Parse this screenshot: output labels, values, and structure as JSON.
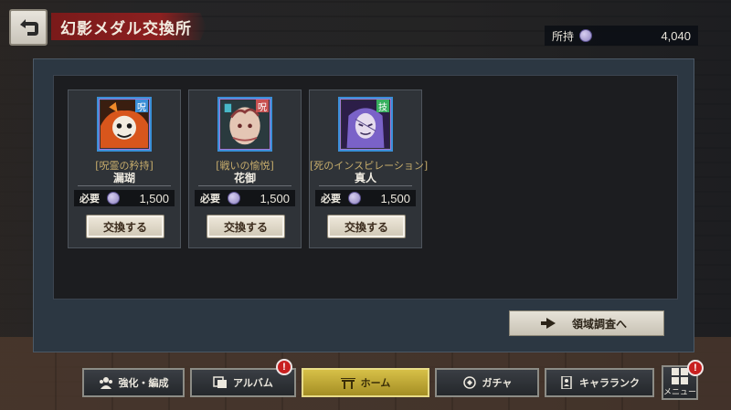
{
  "header": {
    "title": "幻影メダル交換所",
    "own_label": "所持",
    "own_value": "4,040"
  },
  "cards": [
    {
      "sub": "[呪霊の矜持]",
      "name": "漏瑚",
      "need_label": "必要",
      "cost": "1,500",
      "button": "交換する",
      "badge_color": "#3a8fd8"
    },
    {
      "sub": "[戦いの愉悦]",
      "name": "花御",
      "need_label": "必要",
      "cost": "1,500",
      "button": "交換する",
      "badge_color": "#c85050"
    },
    {
      "sub": "[死のインスピレーション]",
      "name": "真人",
      "need_label": "必要",
      "cost": "1,500",
      "button": "交換する",
      "badge_color": "#38b060"
    }
  ],
  "survey_button": "領域調査へ",
  "nav": {
    "enhance": "強化・編成",
    "album": "アルバム",
    "home": "ホーム",
    "gacha": "ガチャ",
    "chara_rank": "キャラランク",
    "menu": "メニュー",
    "alert_mark": "!"
  },
  "colors": {
    "title_banner": "#8c2020",
    "home_active": "#d7c048",
    "alert": "#c82020"
  }
}
